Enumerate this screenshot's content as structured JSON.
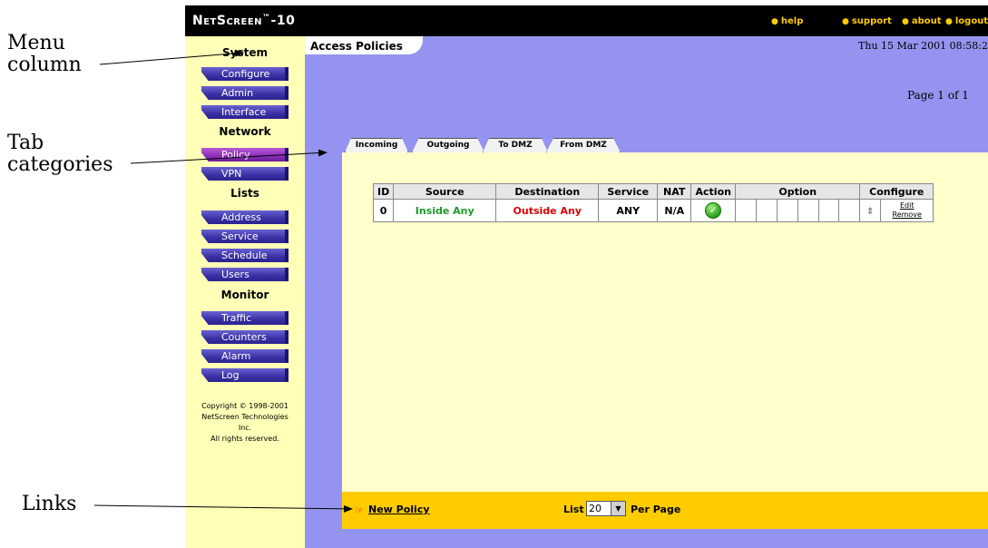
{
  "callouts": {
    "menu": [
      "Menu",
      "column"
    ],
    "tabs": [
      "Tab",
      "categories"
    ],
    "links": "Links"
  },
  "app": {
    "brand": "NetScreen",
    "brand_tm": "™",
    "brand_model": "-10",
    "top_links": [
      "help",
      "support",
      "about",
      "logout"
    ],
    "datetime": "Thu 15 Mar 2001 08:58:2"
  },
  "menu": {
    "sections": [
      {
        "title": "System",
        "items": [
          "Configure",
          "Admin",
          "Interface"
        ]
      },
      {
        "title": "Network",
        "items": [
          "Policy",
          "VPN"
        ]
      },
      {
        "title": "Lists",
        "items": [
          "Address",
          "Service",
          "Schedule",
          "Users"
        ]
      },
      {
        "title": "Monitor",
        "items": [
          "Traffic",
          "Counters",
          "Alarm",
          "Log"
        ]
      }
    ],
    "active_item": "Policy",
    "copyright": [
      "Copyright © 1998-2001",
      "NetScreen Technologies",
      "Inc.",
      "All rights reserved."
    ]
  },
  "page": {
    "title": "Access Policies",
    "page_count": "Page 1 of 1",
    "tabs": [
      "Incoming",
      "Outgoing",
      "To DMZ",
      "From DMZ"
    ],
    "active_tab": "Outgoing"
  },
  "table": {
    "headers": [
      "ID",
      "Source",
      "Destination",
      "Service",
      "NAT",
      "Action",
      "Option",
      "Configure"
    ],
    "rows": [
      {
        "id": "0",
        "source": "Inside Any",
        "destination": "Outside Any",
        "service": "ANY",
        "nat": "N/A",
        "action_icon": "check-icon",
        "configure_links": [
          "Edit",
          "Remove"
        ]
      }
    ]
  },
  "footer": {
    "new_policy": "New Policy",
    "list_label": "List",
    "list_value": "20",
    "per_page": "Per Page"
  },
  "colors": {
    "source": "#1c9a2c",
    "destination": "#e00000",
    "menu_bg": "#ffffb8",
    "panel_bg": "#ffffcc",
    "footer_bg": "#ffcc00",
    "page_bg": "#9494f0"
  }
}
